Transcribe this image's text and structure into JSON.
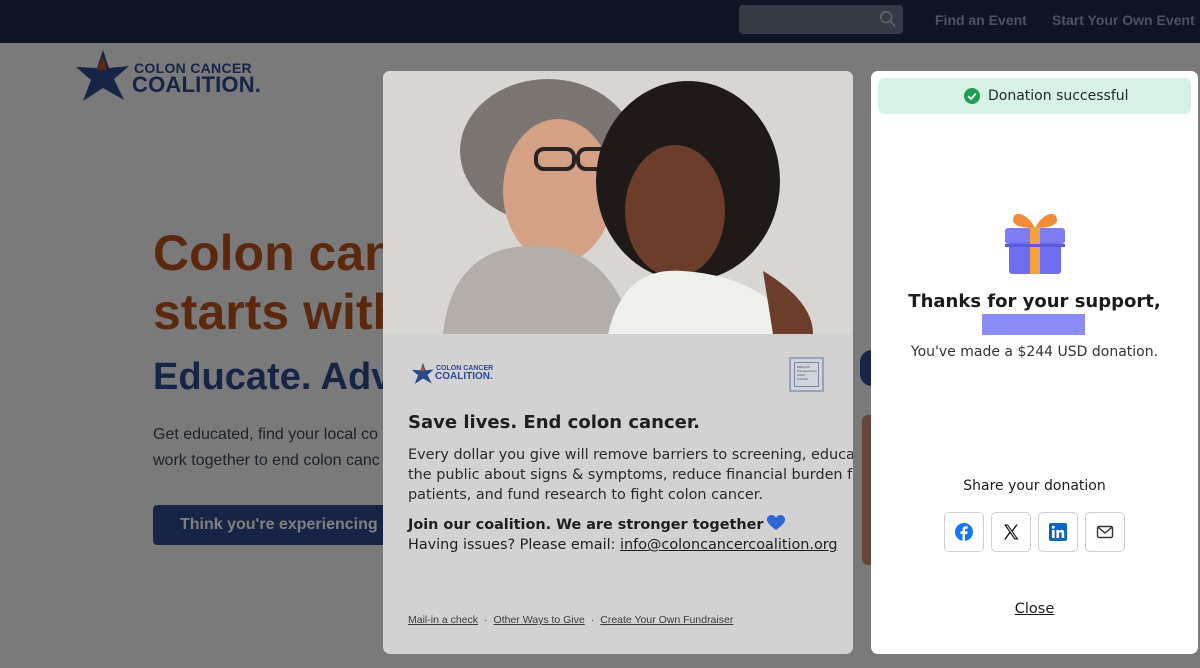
{
  "site": {
    "nav": {
      "find_event": "Find an Event",
      "start_event": "Start Your Own Event",
      "search_icon": "search-icon"
    },
    "logo": {
      "line1": "COLON CANCER",
      "line2": "COALITION."
    },
    "hero": {
      "line1": "Colon canc",
      "line2": "starts with",
      "subhead": "Educate. Advo",
      "para1": "Get educated, find your local co",
      "para2": "work together to end colon canc",
      "button": "Think you're experiencing sy"
    }
  },
  "card": {
    "logo": {
      "line1": "COLON CANCER",
      "line2": "COALITION."
    },
    "seal_text": "Platinum Transparency 2023 Candid.",
    "title": "Save lives. End colon cancer.",
    "desc": [
      "Every dollar you give will remove barriers to screening, educate",
      "the public about signs & symptoms, reduce financial burden for",
      "patients, and fund research to fight colon cancer."
    ],
    "join": "Join our coalition. We are stronger together",
    "heart_icon": "blue-heart-icon",
    "email_prefix": "Having issues? Please email: ",
    "email": "info@coloncancercoalition.org",
    "footer": {
      "mail_check": "Mail-in a check",
      "other_ways": "Other Ways to Give",
      "create": "Create Your Own Fundraiser",
      "separator": "·"
    }
  },
  "panel": {
    "banner": "Donation successful",
    "banner_icon": "check-circle-icon",
    "gift_icon": "gift-icon",
    "thanks": "Thanks for your support,",
    "made": "You've made a $244 USD donation.",
    "share_label": "Share your donation",
    "share_icons": [
      "facebook-icon",
      "x-icon",
      "linkedin-icon",
      "email-icon"
    ],
    "close": "Close"
  },
  "colors": {
    "brand_blue": "#2c4a8a",
    "brand_orange": "#b9521f",
    "topbar": "#1e2b45",
    "success_bg": "#d6f1e6",
    "success_check": "#1f9d55",
    "redaction": "#8b8cf8"
  }
}
